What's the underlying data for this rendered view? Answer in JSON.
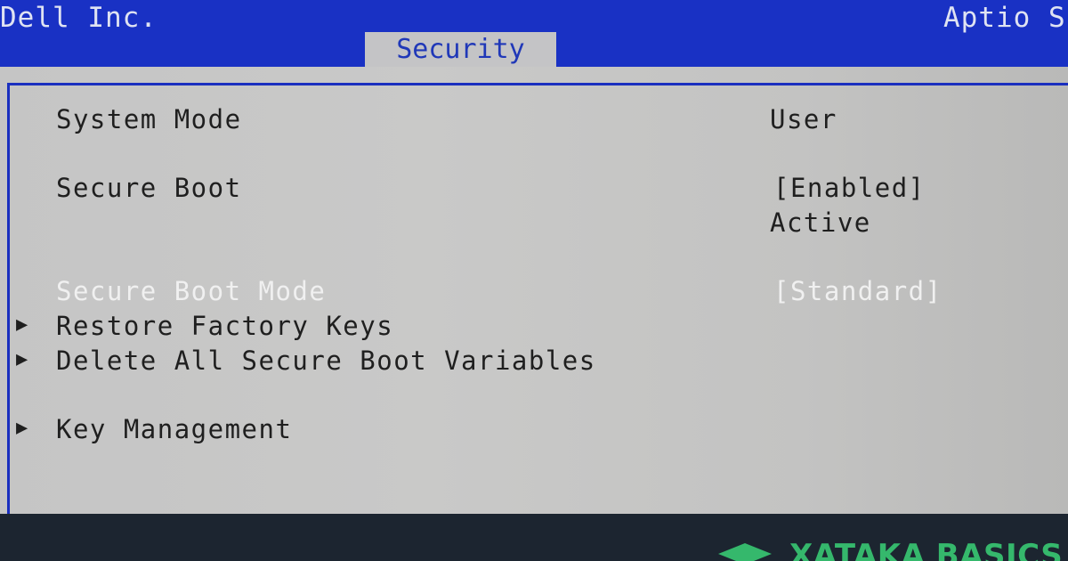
{
  "header": {
    "vendor": "Dell Inc.",
    "firmware": "Aptio S",
    "active_tab": "Security"
  },
  "settings": [
    {
      "label": "System Mode",
      "value": "User"
    },
    {
      "label": "Secure Boot",
      "value": "[Enabled]",
      "status": "Active"
    },
    {
      "label": "Secure Boot Mode",
      "value": "[Standard]"
    }
  ],
  "submenus": [
    "Restore Factory Keys",
    "Delete All Secure Boot Variables",
    "Key Management"
  ],
  "footer": {
    "brand": "XATAKA BASICS",
    "brand_icon": "graduation-cap-icon"
  },
  "colors": {
    "bios_blue": "#1a2fbf",
    "panel_gray": "#c6c6c6",
    "brand_green": "#35b86c",
    "footer_bg": "#1c2530"
  }
}
